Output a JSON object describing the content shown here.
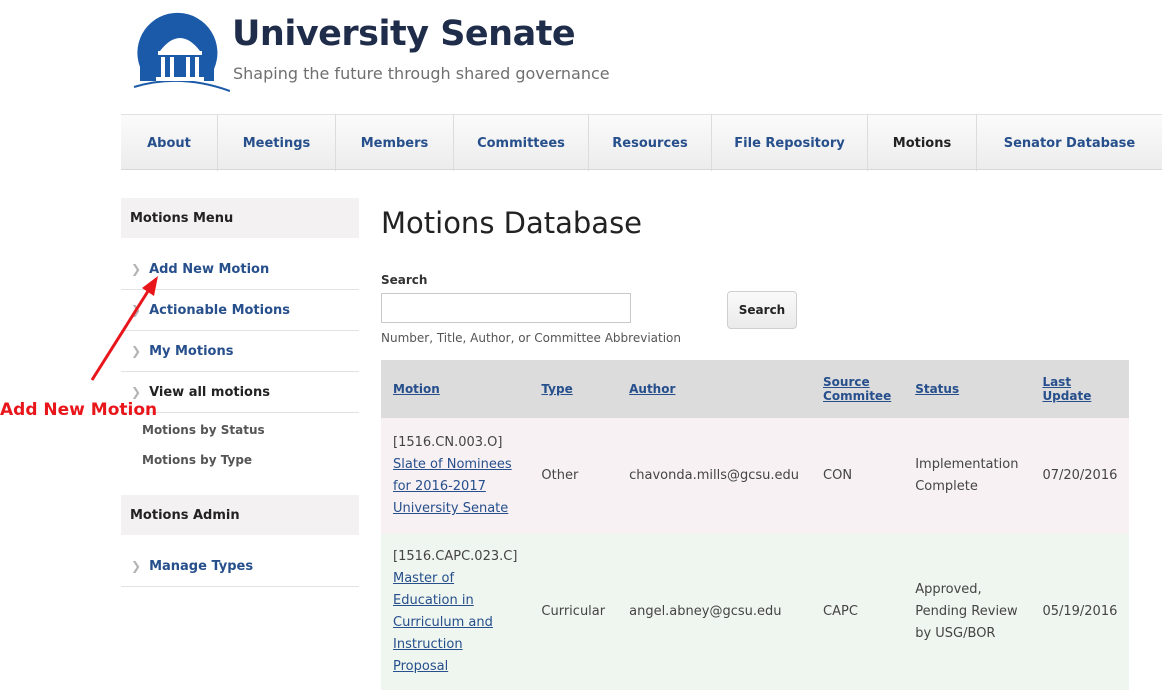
{
  "header": {
    "title": "University Senate",
    "tagline": "Shaping the future through shared governance"
  },
  "nav": {
    "items": [
      {
        "label": "About"
      },
      {
        "label": "Meetings"
      },
      {
        "label": "Members"
      },
      {
        "label": "Committees"
      },
      {
        "label": "Resources"
      },
      {
        "label": "File Repository"
      },
      {
        "label": "Motions"
      },
      {
        "label": "Senator Database"
      }
    ],
    "active": "Motions"
  },
  "sidebar": {
    "menu_title": "Motions Menu",
    "links": [
      {
        "label": "Add New Motion"
      },
      {
        "label": "Actionable Motions"
      },
      {
        "label": "My Motions"
      },
      {
        "label": "View all motions"
      }
    ],
    "sublinks": [
      {
        "label": "Motions by Status"
      },
      {
        "label": "Motions by Type"
      }
    ],
    "admin_title": "Motions Admin",
    "admin_links": [
      {
        "label": "Manage Types"
      }
    ]
  },
  "annotation": {
    "text": "Add New Motion",
    "color": "#e8161b"
  },
  "main": {
    "title": "Motions Database",
    "search": {
      "label": "Search",
      "value": "",
      "placeholder": "",
      "button": "Search",
      "help": "Number, Title, Author, or Committee Abbreviation"
    },
    "table": {
      "headers": {
        "motion": "Motion",
        "type": "Type",
        "author": "Author",
        "source_1": "Source",
        "source_2": "Commitee",
        "status": "Status",
        "updated_1": "Last",
        "updated_2": "Update"
      },
      "rows": [
        {
          "number": "[1516.CN.003.O]",
          "title": "Slate of Nominees for 2016-2017 University Senate",
          "type": "Other",
          "author": "chavonda.mills@gcsu.edu",
          "source": "CON",
          "status": "Implementation Complete",
          "updated": "07/20/2016"
        },
        {
          "number": "[1516.CAPC.023.C]",
          "title": "Master of Education in Curriculum and Instruction Proposal",
          "type": "Curricular",
          "author": "angel.abney@gcsu.edu",
          "source": "CAPC",
          "status": "Approved, Pending Review by USG/BOR",
          "updated": "05/19/2016"
        }
      ]
    }
  },
  "colors": {
    "link": "#264f8c",
    "brand": "#1a5aa8",
    "row_pink": "#f7f1f4",
    "row_green": "#eff5ef"
  }
}
